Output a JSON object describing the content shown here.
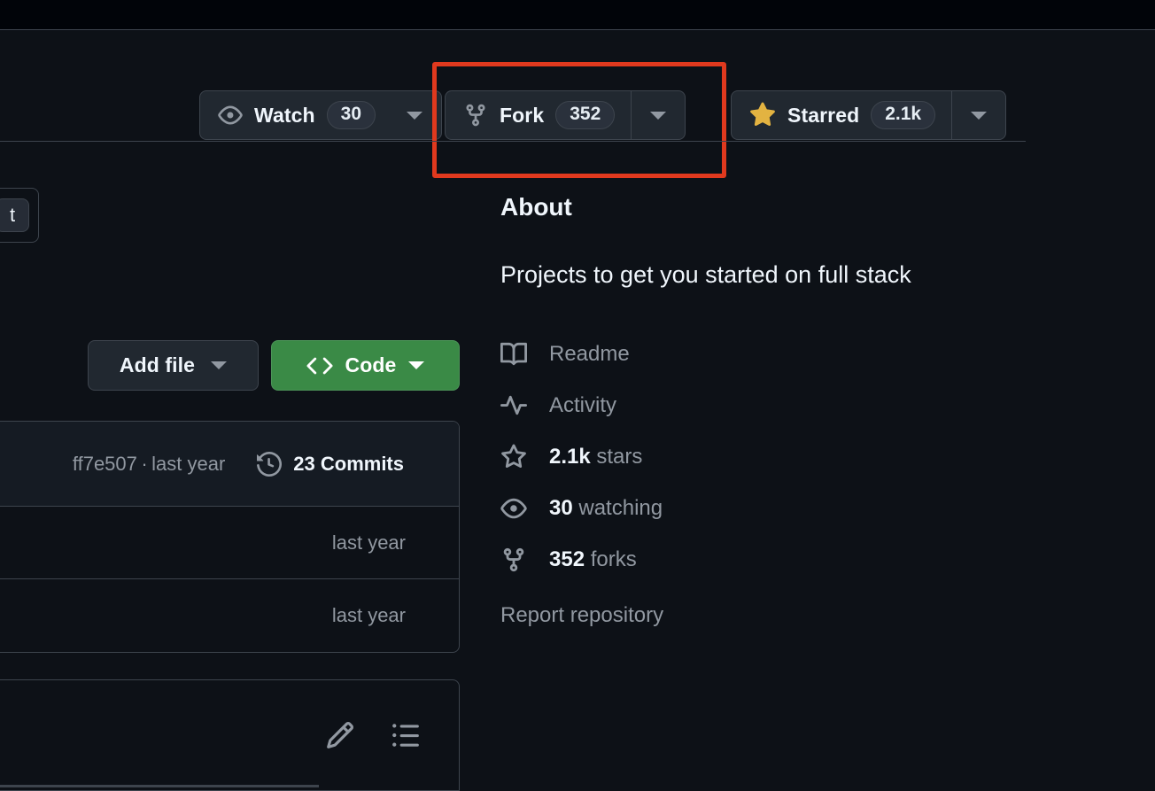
{
  "theme": {
    "page_background": "#0d1117",
    "top_strip_background": "#010409",
    "border": "#3d444d",
    "button_background": "#212830",
    "accent_green": "#3a8a46",
    "star_gold": "#e3b341",
    "highlight_red": "#e0391e",
    "text_primary": "#f0f6fc",
    "text_muted": "#9198a1"
  },
  "action_bar": {
    "watch": {
      "icon": "eye-icon",
      "label": "Watch",
      "count": "30",
      "caret_icon": "chevron-down-icon"
    },
    "fork": {
      "icon": "repo-forked-icon",
      "label": "Fork",
      "count": "352",
      "caret_icon": "chevron-down-icon",
      "highlighted": true
    },
    "star": {
      "icon": "star-filled-icon",
      "label": "Starred",
      "count": "2.1k",
      "caret_icon": "chevron-down-icon"
    }
  },
  "file_toolbar": {
    "avatar_initial": "t",
    "add_file": {
      "label": "Add file",
      "caret_icon": "chevron-down-icon"
    },
    "code": {
      "icon": "code-icon",
      "label": "Code",
      "caret_icon": "chevron-down-icon"
    }
  },
  "commit_bar": {
    "commit_hash": "ff7e507",
    "separator": "·",
    "commit_time": "last year",
    "history_icon": "history-icon",
    "commits_label": "23 Commits"
  },
  "file_rows": [
    {
      "time": "last year"
    },
    {
      "time": "last year"
    }
  ],
  "readme_panel": {
    "edit_icon": "pencil-icon",
    "outline_icon": "list-unordered-icon"
  },
  "about": {
    "title": "About",
    "description": "Projects to get you started on full stack",
    "items": [
      {
        "icon": "book-icon",
        "strong": "",
        "text": "Readme"
      },
      {
        "icon": "pulse-icon",
        "strong": "",
        "text": "Activity"
      },
      {
        "icon": "star-icon",
        "strong": "2.1k",
        "text": "stars"
      },
      {
        "icon": "eye-icon",
        "strong": "30",
        "text": "watching"
      },
      {
        "icon": "repo-forked-icon",
        "strong": "352",
        "text": "forks"
      }
    ],
    "report_link": "Report repository"
  }
}
